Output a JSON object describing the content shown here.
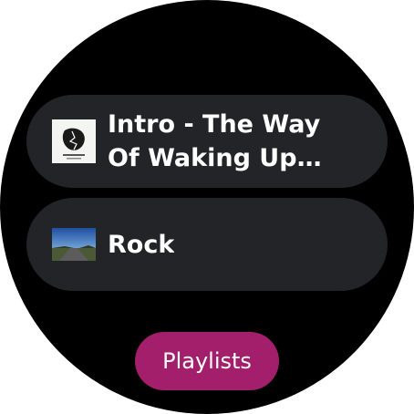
{
  "colors": {
    "screen_background": "#000000",
    "chip_background": "#232427",
    "text": "#ffffff",
    "accent_button": "#a41f6b"
  },
  "list": {
    "items": [
      {
        "label": "Intro - The Way Of Waking Up (feat. The Waking Up Project)",
        "thumbnail": "album-art-icon"
      },
      {
        "label": "Rock",
        "thumbnail": "landscape-road-icon"
      }
    ]
  },
  "actions": {
    "playlists_label": "Playlists"
  }
}
